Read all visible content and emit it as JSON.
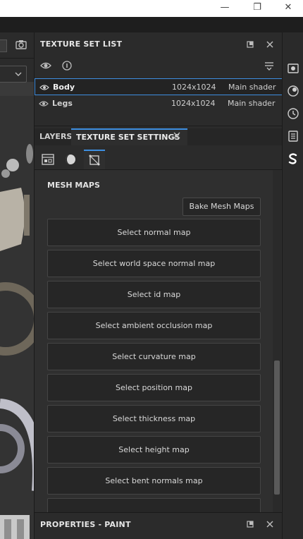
{
  "window": {
    "minimize_glyph": "—",
    "restore_glyph": "❐",
    "close_glyph": "✕"
  },
  "texture_set_list": {
    "title": "TEXTURE SET LIST",
    "rows": [
      {
        "name": "Body",
        "resolution": "1024x1024",
        "shader": "Main shader",
        "selected": true
      },
      {
        "name": "Legs",
        "resolution": "1024x1024",
        "shader": "Main shader",
        "selected": false
      }
    ]
  },
  "tabs": {
    "layers_label": "LAYERS",
    "settings_label": "TEXTURE SET SETTINGS"
  },
  "mesh_maps": {
    "section_title": "MESH MAPS",
    "bake_label": "Bake Mesh Maps",
    "buttons": [
      "Select normal map",
      "Select world space normal map",
      "Select id map",
      "Select ambient occlusion map",
      "Select curvature map",
      "Select position map",
      "Select thickness map",
      "Select height map",
      "Select bent normals map"
    ]
  },
  "properties": {
    "title": "PROPERTIES - PAINT"
  },
  "colors": {
    "accent": "#3d8ee0",
    "panel_bg": "#2b2b2b",
    "button_bg": "#262626"
  },
  "icons": {
    "toolbar_camera": "camera-icon",
    "strip": [
      "display-settings-icon",
      "shader-settings-icon",
      "history-icon",
      "log-icon",
      "substance-share-icon"
    ]
  }
}
